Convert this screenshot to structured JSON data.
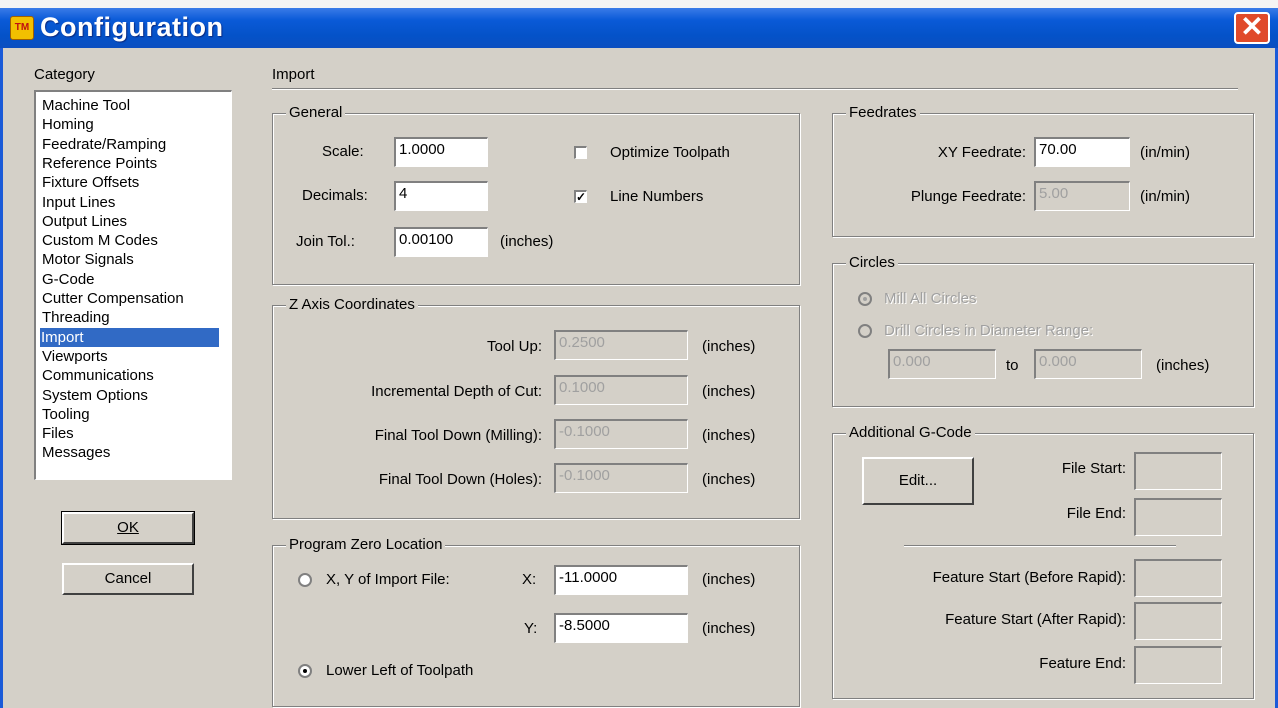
{
  "window": {
    "title": "Configuration",
    "close_glyph": "✕",
    "app_icon_text": "TM"
  },
  "category": {
    "label": "Category",
    "items": [
      "Machine Tool",
      "Homing",
      "Feedrate/Ramping",
      "Reference Points",
      "Fixture Offsets",
      "Input Lines",
      "Output Lines",
      "Custom M Codes",
      "Motor Signals",
      "G-Code",
      "Cutter Compensation",
      "Threading",
      "Import",
      "Viewports",
      "Communications",
      "System Options",
      "Tooling",
      "Files",
      "Messages"
    ],
    "selected": "Import"
  },
  "buttons": {
    "ok": "OK",
    "cancel": "Cancel",
    "edit": "Edit..."
  },
  "page_title": "Import",
  "general": {
    "title": "General",
    "scale_label": "Scale:",
    "scale_value": "1.0000",
    "decimals_label": "Decimals:",
    "decimals_value": "4",
    "join_label": "Join Tol.:",
    "join_value": "0.00100",
    "join_unit": "(inches)",
    "optimize_label": "Optimize Toolpath",
    "optimize_checked": false,
    "linenum_label": "Line Numbers",
    "linenum_checked": true,
    "check_glyph": "✓"
  },
  "z_axis": {
    "title": "Z Axis Coordinates",
    "rows": [
      {
        "label": "Tool Up:",
        "value": "0.2500",
        "unit": "(inches)"
      },
      {
        "label": "Incremental Depth of Cut:",
        "value": "0.1000",
        "unit": "(inches)"
      },
      {
        "label": "Final Tool Down (Milling):",
        "value": "-0.1000",
        "unit": "(inches)"
      },
      {
        "label": "Final Tool Down (Holes):",
        "value": "-0.1000",
        "unit": "(inches)"
      }
    ]
  },
  "program_zero": {
    "title": "Program Zero Location",
    "xy_import_label": "X, Y of Import File:",
    "x_label": "X:",
    "x_value": "-11.0000",
    "x_unit": "(inches)",
    "y_label": "Y:",
    "y_value": "-8.5000",
    "y_unit": "(inches)",
    "lower_left_label": "Lower Left of Toolpath",
    "selected": "lower_left"
  },
  "feedrates": {
    "title": "Feedrates",
    "xy_label": "XY Feedrate:",
    "xy_value": "70.00",
    "xy_unit": "(in/min)",
    "plunge_label": "Plunge Feedrate:",
    "plunge_value": "5.00",
    "plunge_unit": "(in/min)"
  },
  "circles": {
    "title": "Circles",
    "mill_all_label": "Mill All Circles",
    "drill_label": "Drill Circles in Diameter Range:",
    "from_value": "0.000",
    "to_label": "to",
    "to_value": "0.000",
    "unit": "(inches)",
    "selected": "mill_all"
  },
  "additional_gcode": {
    "title": "Additional G-Code",
    "file_start_label": "File Start:",
    "file_end_label": "File End:",
    "feature_start_before_label": "Feature Start (Before Rapid):",
    "feature_start_after_label": "Feature Start (After Rapid):",
    "feature_end_label": "Feature End:"
  }
}
